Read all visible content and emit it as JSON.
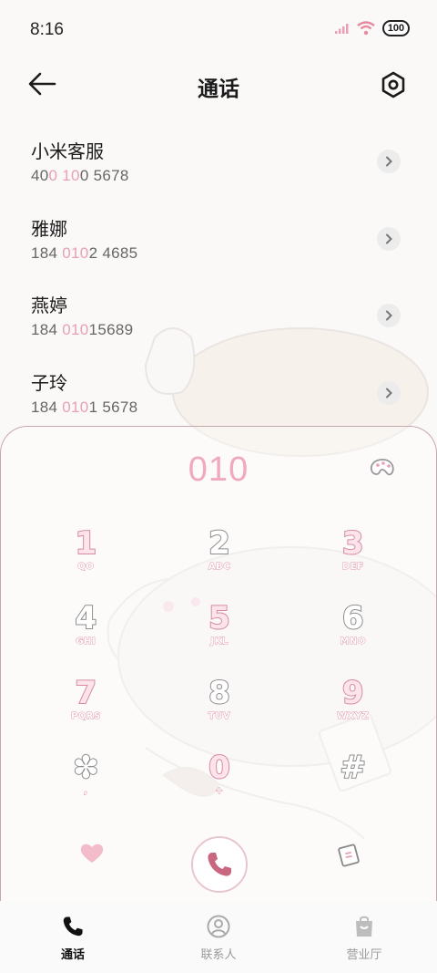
{
  "status_bar": {
    "time": "8:16",
    "battery": "100",
    "icons": [
      "signal-icon",
      "wifi-icon",
      "battery-icon"
    ]
  },
  "header": {
    "title": "通话",
    "back_icon": "arrow-left-icon",
    "settings_icon": "settings-hexagon-icon"
  },
  "contacts": [
    {
      "name": "小米客服",
      "num_pre": "40",
      "num_hl": "0 10",
      "num_post": "0 5678"
    },
    {
      "name": "雅娜",
      "num_pre": "184 ",
      "num_hl": "010",
      "num_post": "2 4685"
    },
    {
      "name": "燕婷",
      "num_pre": "184 ",
      "num_hl": "010",
      "num_post": "15689"
    },
    {
      "name": "子玲",
      "num_pre": "184 ",
      "num_hl": "010",
      "num_post": "1 5678"
    }
  ],
  "dialer": {
    "display": "010",
    "keys": [
      {
        "digit": "1",
        "letters": "QO"
      },
      {
        "digit": "2",
        "letters": "ABC"
      },
      {
        "digit": "3",
        "letters": "DEF"
      },
      {
        "digit": "4",
        "letters": "GHI"
      },
      {
        "digit": "5",
        "letters": "JKL"
      },
      {
        "digit": "6",
        "letters": "MNO"
      },
      {
        "digit": "7",
        "letters": "PQRS"
      },
      {
        "digit": "8",
        "letters": "TUV"
      },
      {
        "digit": "9",
        "letters": "WXYZ"
      },
      {
        "digit": "✽",
        "letters": ","
      },
      {
        "digit": "0",
        "letters": "+"
      },
      {
        "digit": "#",
        "letters": ""
      }
    ]
  },
  "bottom_nav": [
    {
      "label": "通话",
      "icon": "phone-icon",
      "active": true
    },
    {
      "label": "联系人",
      "icon": "contact-person-icon",
      "active": false
    },
    {
      "label": "营业厅",
      "icon": "shopping-bag-icon",
      "active": false
    }
  ],
  "colors": {
    "accent_pink": "#f0a9bd",
    "call_icon": "#c8677f",
    "text_primary": "#1b1b1b",
    "text_secondary": "#666666"
  }
}
